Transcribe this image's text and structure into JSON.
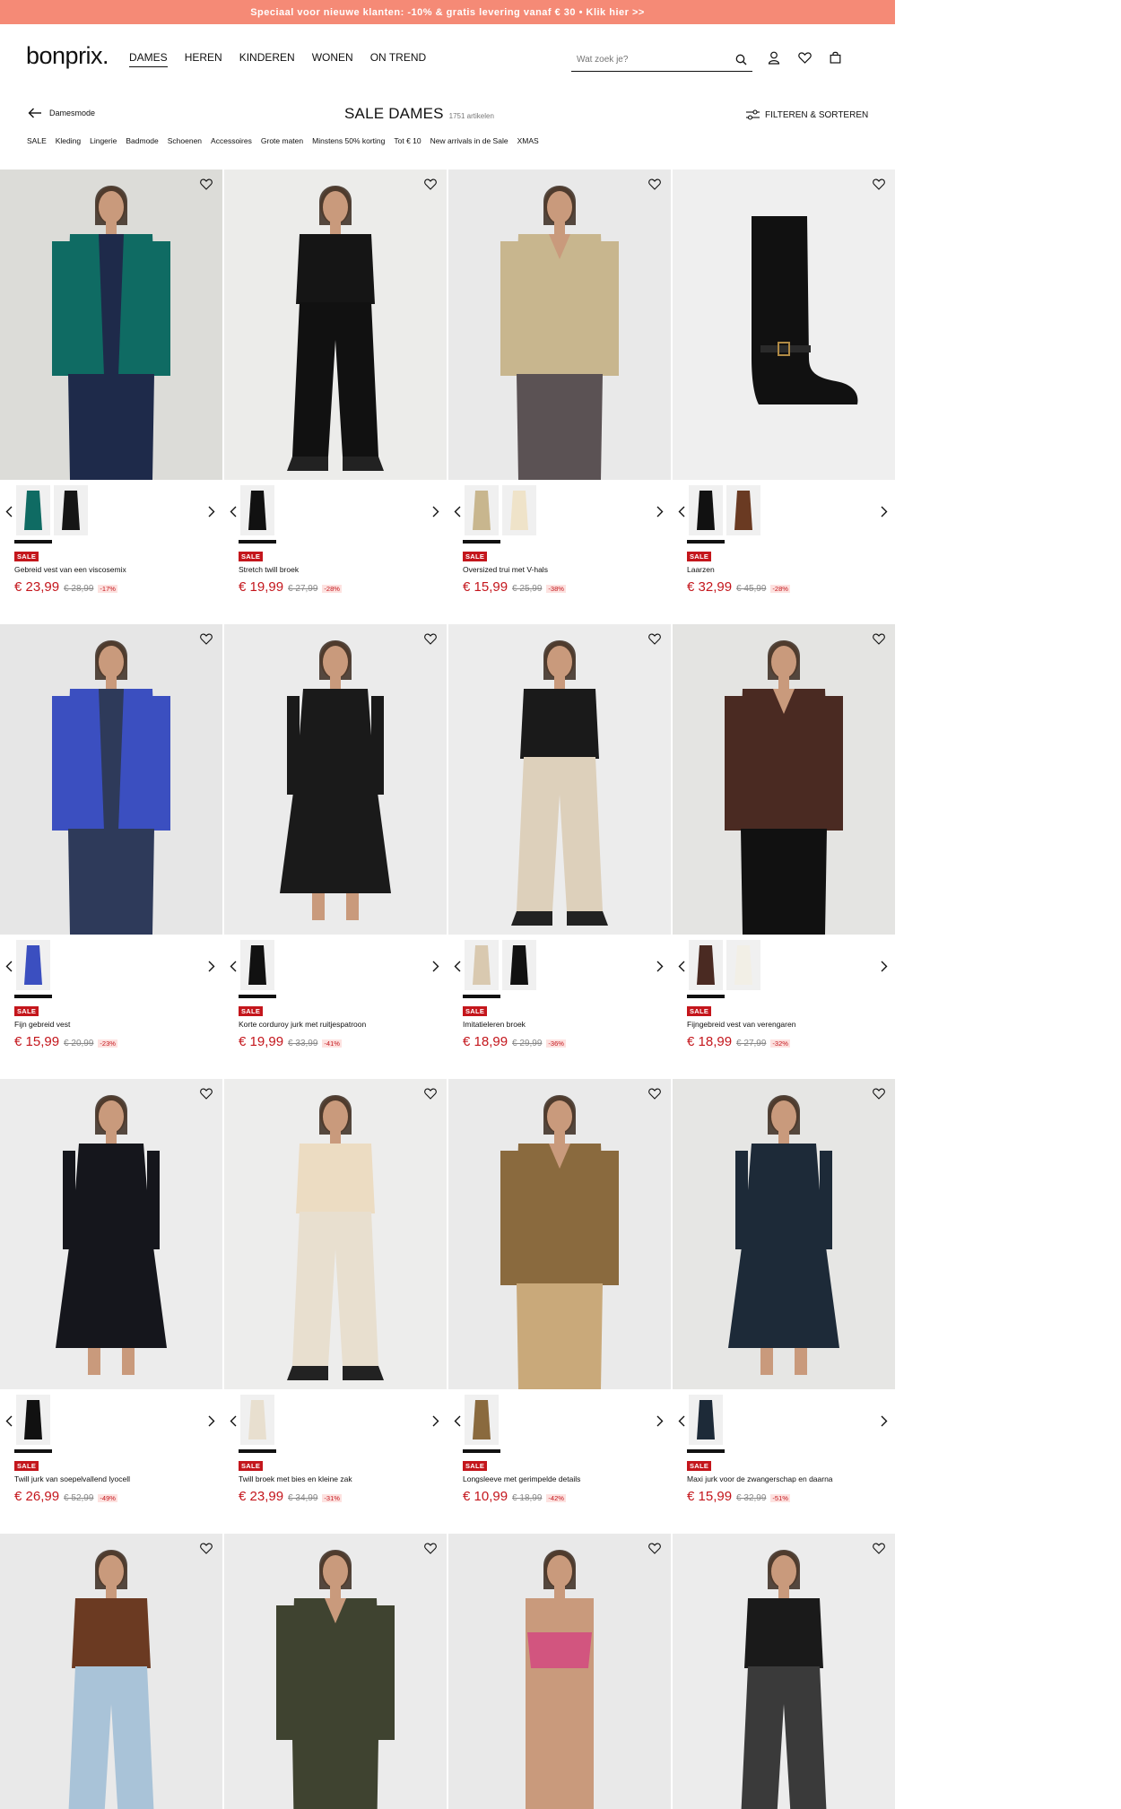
{
  "promo": {
    "text": "Speciaal voor nieuwe klanten: -10% & gratis levering vanaf € 30 • Klik hier >>"
  },
  "header": {
    "logo": "bonprix.",
    "nav": [
      "DAMES",
      "HEREN",
      "KINDEREN",
      "WONEN",
      "ON TREND"
    ],
    "active_nav": "DAMES",
    "search_placeholder": "Wat zoek je?"
  },
  "subhead": {
    "back_label": "Damesmode",
    "title": "SALE DAMES",
    "count": "1751 artikelen",
    "filter_label": "FILTEREN & SORTEREN",
    "categories": [
      "SALE",
      "Kleding",
      "Lingerie",
      "Badmode",
      "Schoenen",
      "Accessoires",
      "Grote maten",
      "Minstens 50% korting",
      "Tot € 10",
      "New arrivals in de Sale",
      "XMAS"
    ]
  },
  "colors": {
    "promo_bg": "#f58a76",
    "sale_red": "#c4161c",
    "discount_bg": "#fde2e0"
  },
  "products": [
    {
      "name": "Gebreid vest van een viscosemix",
      "badge": "SALE",
      "price": "€ 23,99",
      "old": "€ 28,99",
      "disc": "-17%",
      "swatches": [
        "#0f6b63",
        "#151515"
      ],
      "bg": "#dcdcd8",
      "top": "#0f6b63",
      "bottom": "#1e2a4a",
      "kind": "cardigan"
    },
    {
      "name": "Stretch twill broek",
      "badge": "SALE",
      "price": "€ 19,99",
      "old": "€ 27,99",
      "disc": "-28%",
      "swatches": [
        "#111111"
      ],
      "bg": "#ececea",
      "top": "#151515",
      "bottom": "#111111",
      "kind": "pants"
    },
    {
      "name": "Oversized trui met V-hals",
      "badge": "SALE",
      "price": "€ 15,99",
      "old": "€ 25,99",
      "disc": "-38%",
      "swatches": [
        "#c8b68e",
        "#efe3c9"
      ],
      "bg": "#e9e9e9",
      "top": "#c8b68e",
      "bottom": "#5b5254",
      "kind": "sweater"
    },
    {
      "name": "Laarzen",
      "badge": "SALE",
      "price": "€ 32,99",
      "old": "€ 45,99",
      "disc": "-28%",
      "swatches": [
        "#111111",
        "#6a3a22"
      ],
      "bg": "#efefef",
      "top": "#111111",
      "bottom": "#111111",
      "kind": "boot"
    },
    {
      "name": "Fijn gebreid vest",
      "badge": "SALE",
      "price": "€ 15,99",
      "old": "€ 20,99",
      "disc": "-23%",
      "swatches": [
        "#3b4fc0"
      ],
      "bg": "#e6e6e6",
      "top": "#3b4fc0",
      "bottom": "#2e3a5a",
      "kind": "cardigan"
    },
    {
      "name": "Korte corduroy jurk met ruitjespatroon",
      "badge": "SALE",
      "price": "€ 19,99",
      "old": "€ 33,99",
      "disc": "-41%",
      "swatches": [
        "#111111"
      ],
      "bg": "#ebebeb",
      "top": "#1a1a1a",
      "bottom": "#1a1a1a",
      "kind": "dress"
    },
    {
      "name": "Imitatieleren broek",
      "badge": "SALE",
      "price": "€ 18,99",
      "old": "€ 29,99",
      "disc": "-36%",
      "swatches": [
        "#d9c9b0",
        "#111111"
      ],
      "bg": "#ececec",
      "top": "#1a1a1a",
      "bottom": "#ddd0bb",
      "kind": "pants"
    },
    {
      "name": "Fijngebreid vest van verengaren",
      "badge": "SALE",
      "price": "€ 18,99",
      "old": "€ 27,99",
      "disc": "-32%",
      "swatches": [
        "#4a2a22",
        "#f2efe6"
      ],
      "bg": "#e4e4e2",
      "top": "#4a2a22",
      "bottom": "#111111",
      "kind": "sweater"
    },
    {
      "name": "Twill jurk van soepelvallend lyocell",
      "badge": "SALE",
      "price": "€ 26,99",
      "old": "€ 52,99",
      "disc": "-49%",
      "swatches": [
        "#111111"
      ],
      "bg": "#ececec",
      "top": "#15161c",
      "bottom": "#15161c",
      "kind": "dress"
    },
    {
      "name": "Twill broek met bies en kleine zak",
      "badge": "SALE",
      "price": "€ 23,99",
      "old": "€ 34,99",
      "disc": "-31%",
      "swatches": [
        "#e8dfcf"
      ],
      "bg": "#ededec",
      "top": "#ecdcc2",
      "bottom": "#e8dfcf",
      "kind": "pants"
    },
    {
      "name": "Longsleeve met gerimpelde details",
      "badge": "SALE",
      "price": "€ 10,99",
      "old": "€ 18,99",
      "disc": "-42%",
      "swatches": [
        "#8a6a3e"
      ],
      "bg": "#eaeaea",
      "top": "#8a6a3e",
      "bottom": "#c9a97a",
      "kind": "sweater"
    },
    {
      "name": "Maxi jurk voor de zwangerschap en daarna",
      "badge": "SALE",
      "price": "€ 15,99",
      "old": "€ 32,99",
      "disc": "-51%",
      "swatches": [
        "#1d2a38"
      ],
      "bg": "#e6e6e4",
      "top": "#1d2a38",
      "bottom": "#1d2a38",
      "kind": "dress"
    },
    {
      "bg": "#e9e9e9",
      "top": "#6b3a22",
      "bottom": "#a9c3d8",
      "kind": "pants"
    },
    {
      "bg": "#ebebeb",
      "top": "#3f4330",
      "bottom": "#3f4330",
      "kind": "sweater"
    },
    {
      "bg": "#e9e9e9",
      "top": "#d2557f",
      "bottom": "#d2557f",
      "kind": "bra"
    },
    {
      "bg": "#ececec",
      "top": "#1a1a1a",
      "bottom": "#3a3a3a",
      "kind": "pants"
    }
  ]
}
